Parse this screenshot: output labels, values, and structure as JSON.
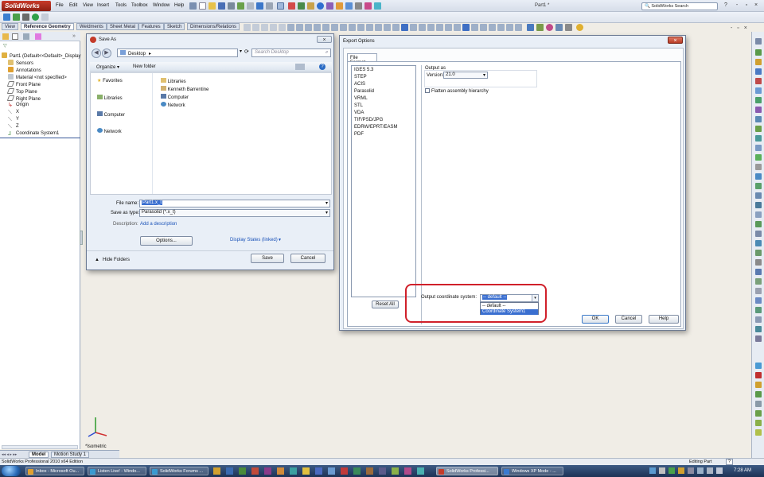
{
  "app": {
    "logo": "SolidWorks",
    "menu": [
      "File",
      "Edit",
      "View",
      "Insert",
      "Tools",
      "Toolbox",
      "Window",
      "Help"
    ],
    "doc_title": "Part1 *",
    "search_placeholder": "SolidWorks Search",
    "window_controls": [
      "?",
      "-",
      "▫",
      "×"
    ]
  },
  "command_tabs": [
    "View",
    "Reference Geometry",
    "Weldments",
    "Sheet Metal",
    "Features",
    "Sketch",
    "Dimensions/Relations"
  ],
  "active_command_tab": "Reference Geometry",
  "tree": {
    "root": "Part1 (Default<<Default>_Display",
    "items": [
      "Sensors",
      "Annotations",
      "Material <not specified>",
      "Front Plane",
      "Top Plane",
      "Right Plane",
      "Origin",
      "X",
      "Y",
      "Z",
      "Coordinate System1"
    ]
  },
  "save_as": {
    "title": "Save As",
    "breadcrumb": "Desktop",
    "search_placeholder": "Search Desktop",
    "organize": "Organize ▾",
    "new_folder": "New folder",
    "nav": [
      "Favorites",
      "Libraries",
      "Computer",
      "Network"
    ],
    "files": [
      "Libraries",
      "Kenneth Barrentine",
      "Computer",
      "Network"
    ],
    "file_name_label": "File name:",
    "file_name_value": "Part1.x_t",
    "save_type_label": "Save as type:",
    "save_type_value": "Parasolid (*.x_t)",
    "description_label": "Description:",
    "description_link": "Add a description",
    "options_button": "Options...",
    "display_states": "Display States (linked)",
    "hide_folders": "Hide Folders",
    "save_button": "Save",
    "cancel_button": "Cancel"
  },
  "export": {
    "title": "Export Options",
    "tab": "File Format",
    "formats": [
      "IGES 5.3",
      "STEP",
      "ACIS",
      "Parasolid",
      "VRML",
      "STL",
      "VDA",
      "TIF/PSD/JPG",
      "EDRW/EPRT/EASM",
      "PDF"
    ],
    "output_as": "Output as",
    "version_label": "Version:",
    "version_value": "21.0",
    "flatten": "Flatten assembly hierarchy",
    "reset_all": "Reset All",
    "coord_label": "Output coordinate system:",
    "coord_value": "-- default --",
    "coord_options": [
      "-- default --",
      "Coordinate System1"
    ],
    "ok": "OK",
    "cancel": "Cancel",
    "help": "Help"
  },
  "viewport": {
    "view_label": "*Isometric"
  },
  "bottom_tabs": [
    "Model",
    "Motion Study 1"
  ],
  "status": {
    "left": "SolidWorks Professional 2010 x64 Edition",
    "right": "Editing Part",
    "help_icon": "?"
  },
  "taskbar": {
    "items": [
      "Inbox - Microsoft Ou...",
      "Listen Live! - Windo...",
      "SolidWorks Forums ...",
      "SolidWorks Professi...",
      "Windows XP Mode - ..."
    ],
    "time": "7:28 AM"
  }
}
